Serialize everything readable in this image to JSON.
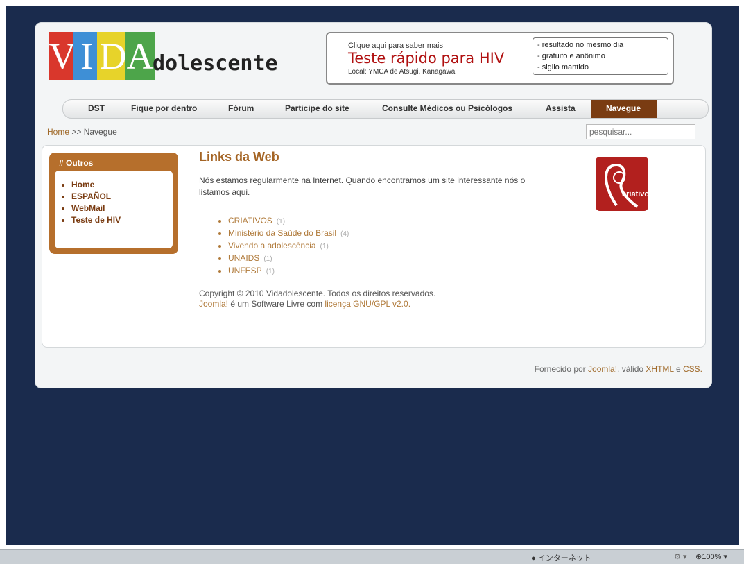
{
  "logo": {
    "letters": [
      "V",
      "I",
      "D",
      "A"
    ],
    "rest": "dolescente"
  },
  "banner": {
    "small": "Clique aqui para saber mais",
    "big": "Teste rápido para HIV",
    "local": "Local: YMCA de Atsugi, Kanagawa",
    "bullets": [
      "- resultado no mesmo dia",
      "- gratuito e anônimo",
      "- sigilo mantido"
    ]
  },
  "nav": [
    "DST",
    "Fique por dentro",
    "Fórum",
    "Participe do site",
    "Consulte Médicos ou Psicólogos",
    "Assista",
    "Navegue"
  ],
  "breadcrumb": {
    "home": "Home",
    "sep": ">>",
    "current": "Navegue"
  },
  "search": {
    "placeholder": "pesquisar..."
  },
  "sidebar": {
    "title": "# Outros",
    "items": [
      "Home",
      "ESPAÑOL",
      "WebMail",
      "Teste de HIV"
    ]
  },
  "main": {
    "heading": "Links da Web",
    "intro": "Nós estamos regularmente na Internet. Quando encontramos um site interessante nós o listamos aqui.",
    "links": [
      {
        "label": "CRIATIVOS",
        "count": "(1)"
      },
      {
        "label": "Ministério da Saúde do Brasil",
        "count": "(4)"
      },
      {
        "label": "Vivendo a adolescência",
        "count": "(1)"
      },
      {
        "label": "UNAIDS",
        "count": "(1)"
      },
      {
        "label": "UNFESP",
        "count": "(1)"
      }
    ],
    "copyright": "Copyright © 2010 Vidadolescente. Todos os direitos reservados.",
    "joomla": "Joomla!",
    "software": " é um Software Livre com ",
    "license": "licença GNU/GPL v2.0."
  },
  "partner": {
    "name": "criativos"
  },
  "footer": {
    "pre": "Fornecido por ",
    "joomla": "Joomla!",
    "valid": ". válido ",
    "xhtml": "XHTML",
    "and": " e ",
    "css": "CSS."
  },
  "taskbar": {
    "network": "インターネット",
    "zoom": "100%"
  },
  "colors": {
    "accent": "#b66f2c",
    "nav_active": "#7a3c12",
    "brand_red": "#b01010",
    "desktop": "#1a2b4d"
  }
}
